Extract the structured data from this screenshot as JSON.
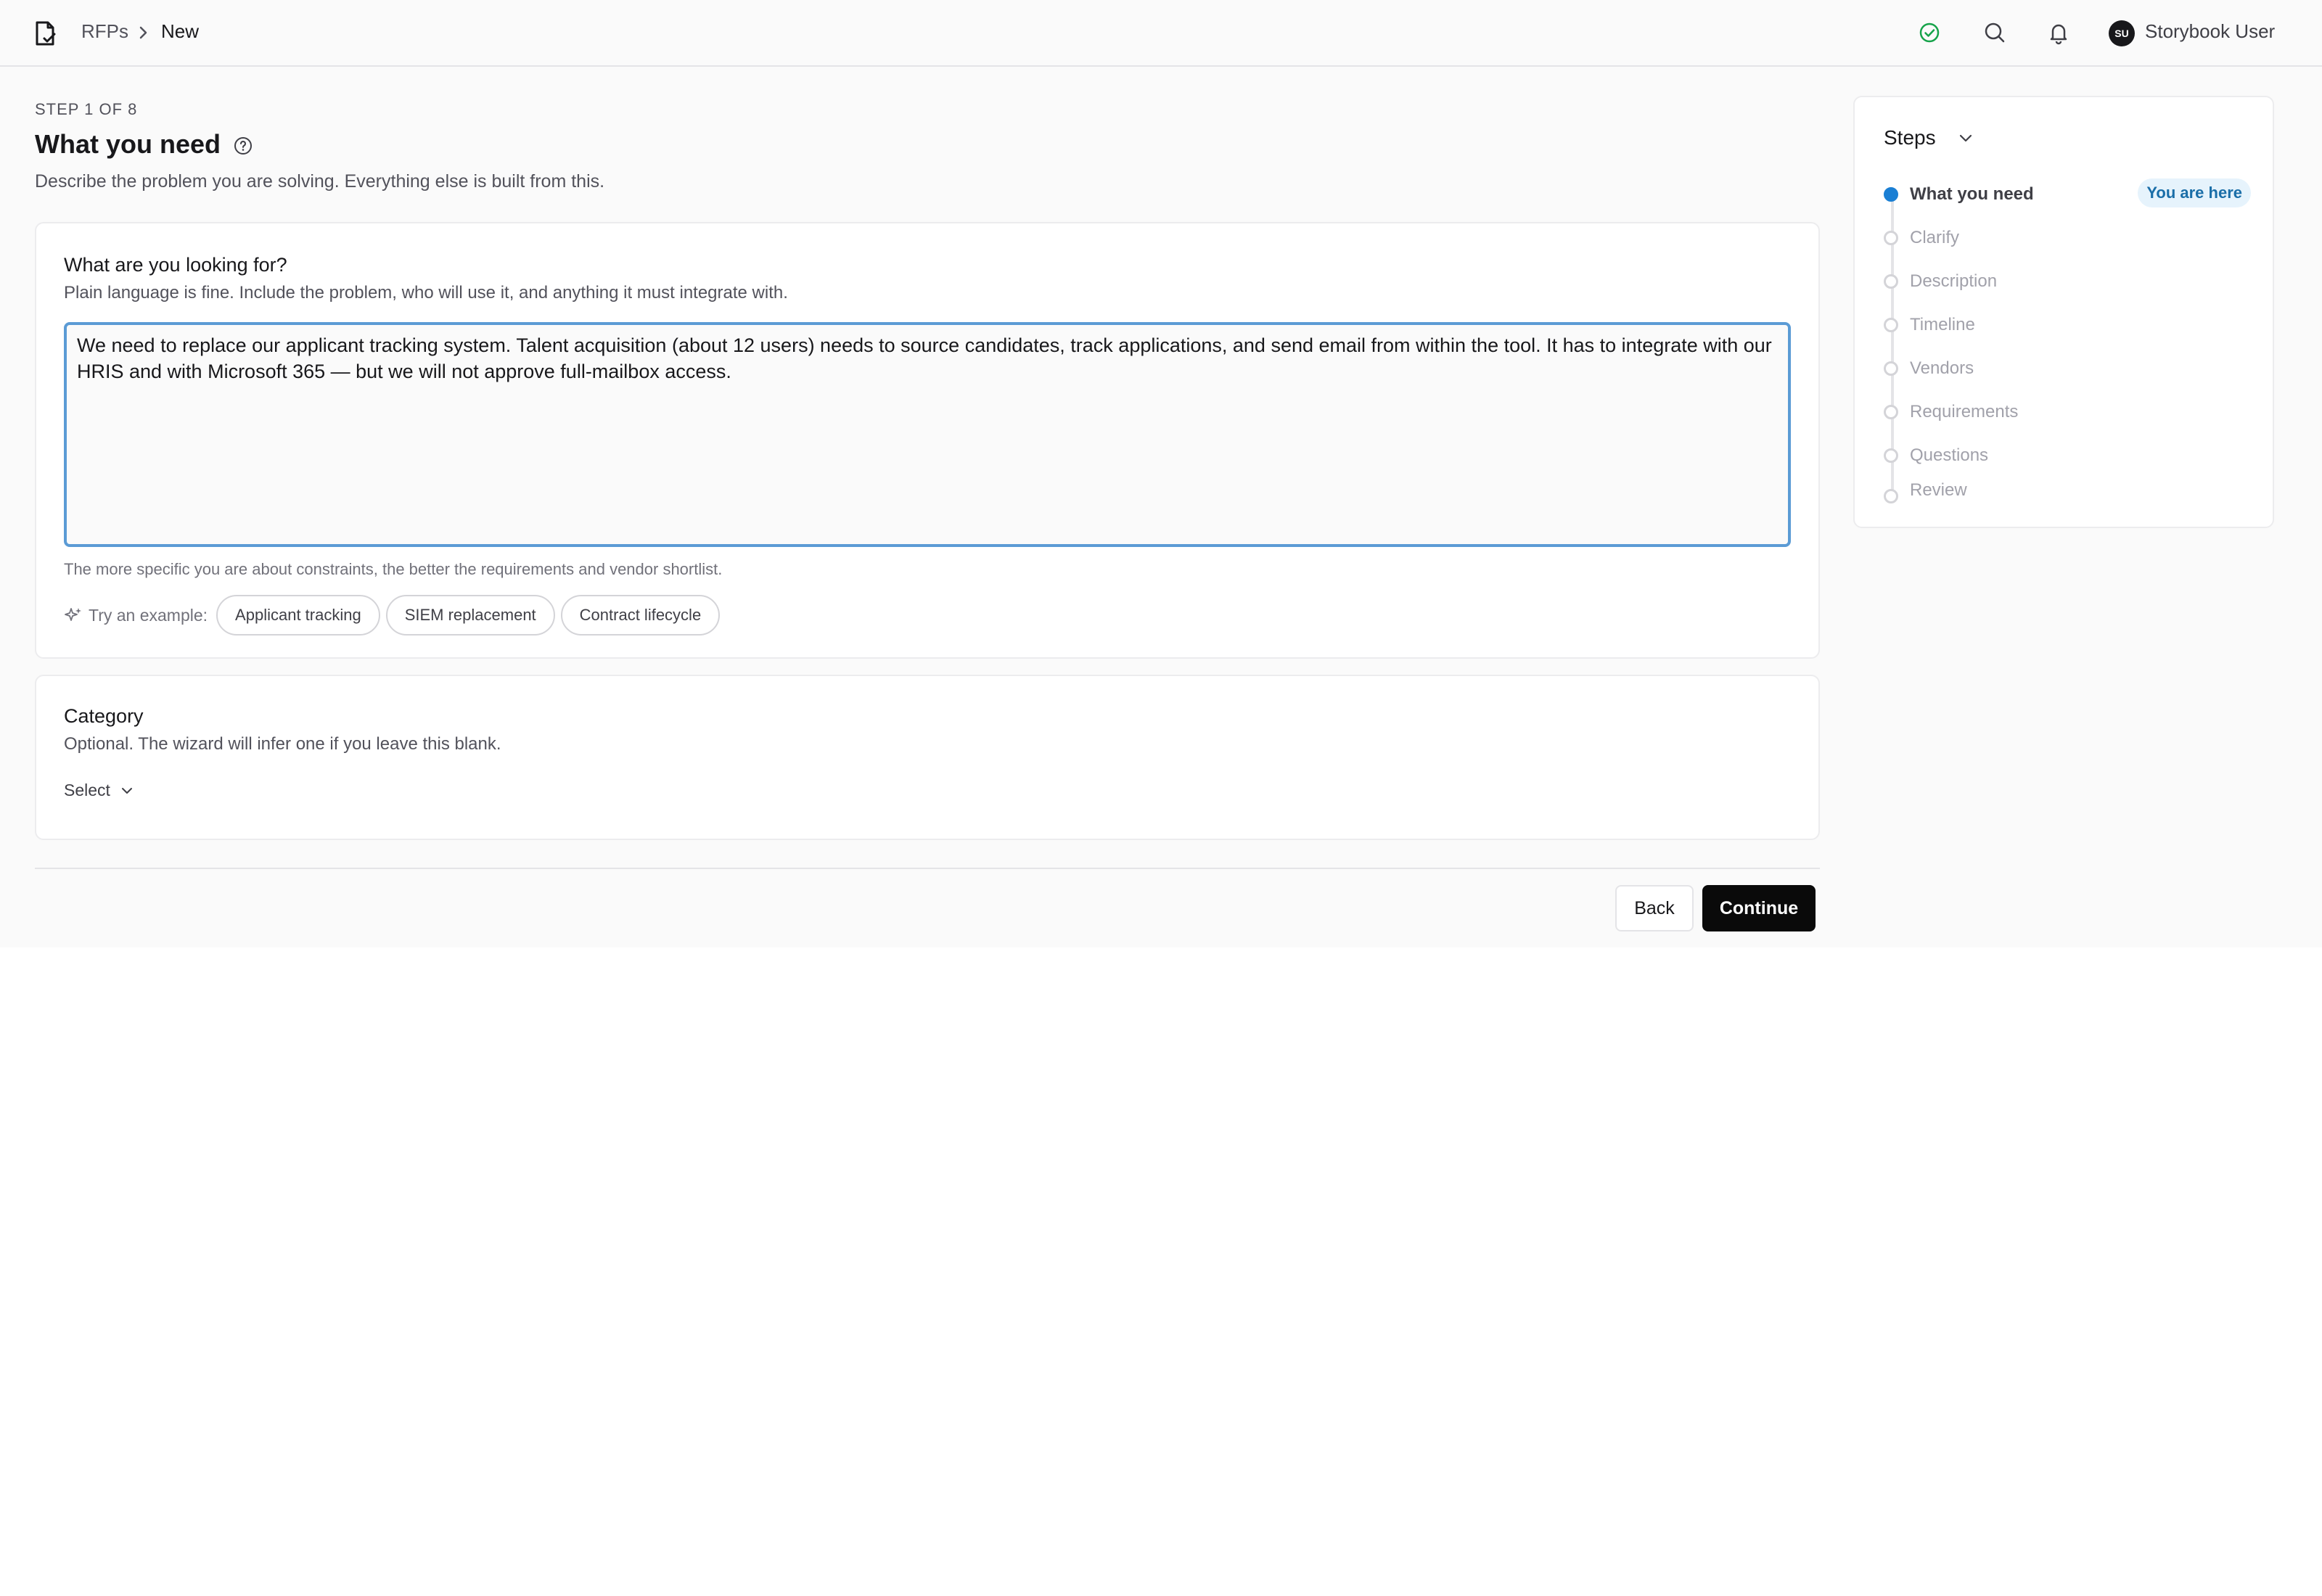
{
  "header": {
    "breadcrumb_root": "RFPs",
    "breadcrumb_current": "New",
    "avatar_initials": "SU",
    "user_name": "Storybook User",
    "icons": [
      "document-check-icon",
      "check-circle-icon",
      "search-icon",
      "bell-icon"
    ]
  },
  "page": {
    "step_indicator": "STEP 1 OF 8",
    "title": "What you need",
    "subtitle": "Describe the problem you are solving. Everything else is built from this."
  },
  "need_card": {
    "label": "What are you looking for?",
    "help": "Plain language is fine. Include the problem, who will use it, and anything it must integrate with.",
    "value": "We need to replace our applicant tracking system. Talent acquisition (about 12 users) needs to source candidates, track applications, and send email from within the tool. It has to integrate with our HRIS and with Microsoft 365 — but we will not approve full-mailbox access.",
    "hint": "The more specific you are about constraints, the better the requirements and vendor shortlist.",
    "examples_label": "Try an example:",
    "examples": [
      "Applicant tracking",
      "SIEM replacement",
      "Contract lifecycle"
    ]
  },
  "category_card": {
    "label": "Category",
    "help": "Optional. The wizard will infer one if you leave this blank.",
    "select_value": "Select"
  },
  "actions": {
    "back_label": "Back",
    "continue_label": "Continue"
  },
  "steps_panel": {
    "title": "Steps",
    "current_badge": "You are here",
    "items": [
      {
        "label": "What you need",
        "active": true
      },
      {
        "label": "Clarify",
        "active": false
      },
      {
        "label": "Description",
        "active": false
      },
      {
        "label": "Timeline",
        "active": false
      },
      {
        "label": "Vendors",
        "active": false
      },
      {
        "label": "Requirements",
        "active": false
      },
      {
        "label": "Questions",
        "active": false
      },
      {
        "label": "Review",
        "active": false
      }
    ]
  },
  "colors": {
    "accent": "#1a7fd4",
    "focus_border": "#5b9bd5",
    "primary_button": "#0a0a0a",
    "status_ok": "#16a34a"
  }
}
